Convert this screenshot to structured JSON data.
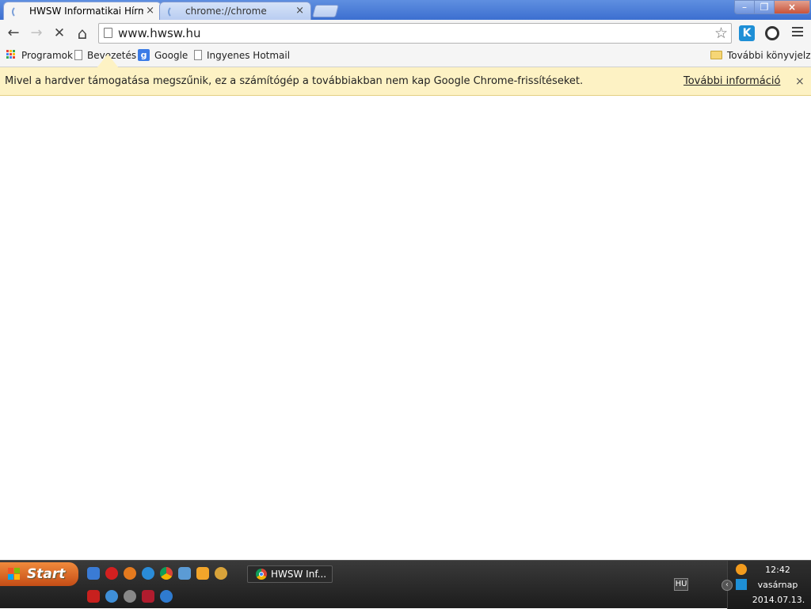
{
  "browser": {
    "tabs": [
      {
        "title": "HWSW Informatikai Hírmagazin",
        "close": "×",
        "active": true
      },
      {
        "title": "chrome://chrome",
        "close": "×",
        "active": false
      }
    ],
    "window_controls": {
      "minimize": "–",
      "maximize": "❐",
      "close": "×"
    },
    "toolbar": {
      "back_icon": "←",
      "forward_icon": "→",
      "stop_icon": "✕",
      "home_icon": "⌂",
      "url": "www.hwsw.hu",
      "star_icon": "☆"
    },
    "bookmarks": [
      {
        "label": "Programok",
        "icon": "apps-grid-icon"
      },
      {
        "label": "Bevezetés",
        "icon": "page-icon"
      },
      {
        "label": "Google",
        "icon": "google-icon"
      },
      {
        "label": "Ingyenes Hotmail",
        "icon": "page-icon"
      }
    ],
    "other_bookmarks": "További könyvjelzők",
    "infobar": {
      "message": "Mivel a hardver támogatása megszűnik, ez a számítógép a továbbiakban nem kap Google Chrome-frissítéseket.",
      "link": "További információ",
      "close": "×"
    }
  },
  "taskbar": {
    "start_label": "Start",
    "window_button": "HWSW Inf...",
    "language": "HU",
    "clock": {
      "time": "12:42",
      "day": "vasárnap",
      "date": "2014.07.13."
    }
  },
  "colors": {
    "titlebar": "#3c6fd0",
    "infobar": "#fdf2c4",
    "start": "#e06a2a"
  }
}
